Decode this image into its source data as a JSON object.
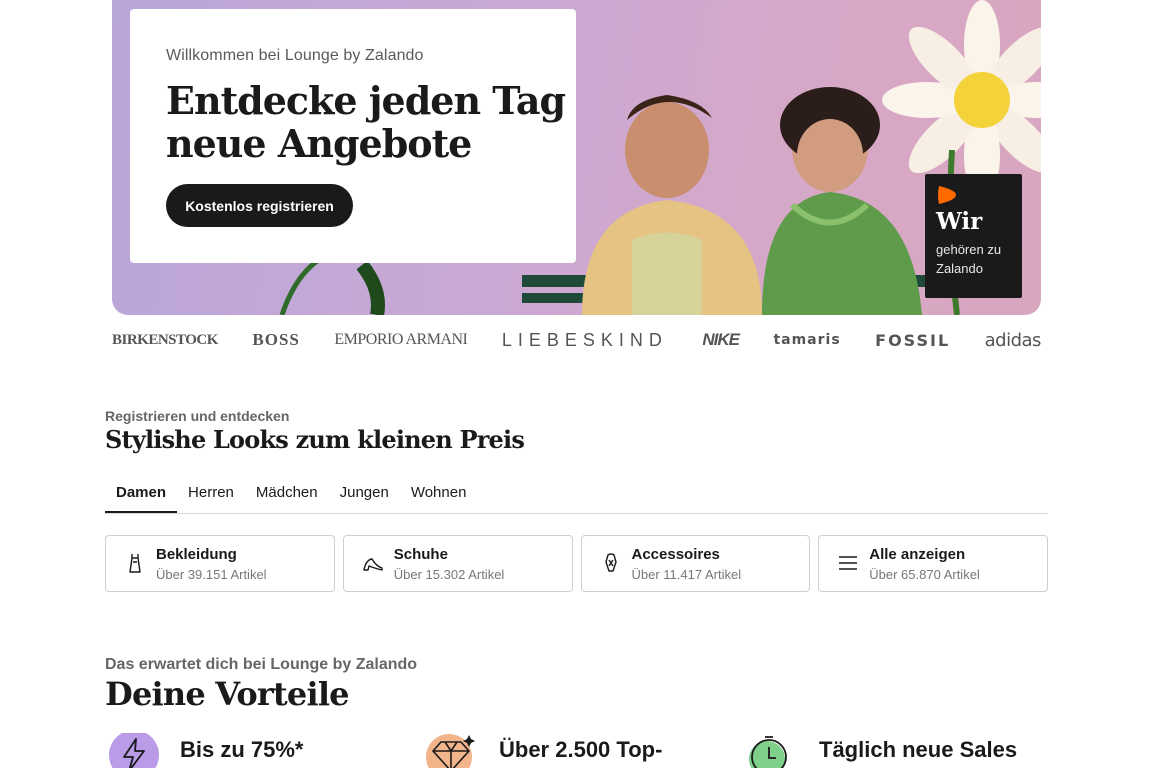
{
  "hero": {
    "subtitle": "Willkommen bei Lounge by Zalando",
    "title_line1": "Entdecke jeden Tag",
    "title_line2": "neue Angebote",
    "cta_label": "Kostenlos registrieren",
    "badge": {
      "title": "Wir",
      "line1": "gehören zu",
      "line2": "Zalando"
    }
  },
  "brands": [
    "BIRKENSTOCK",
    "BOSS",
    "EMPORIO ARMANI",
    "LIEBESKIND",
    "NIKE",
    "tamaris",
    "FOSSIL",
    "adidas"
  ],
  "discover": {
    "subtitle": "Registrieren und entdecken",
    "title": "Stylishe Looks zum kleinen Preis",
    "tabs": [
      {
        "label": "Damen",
        "active": true
      },
      {
        "label": "Herren",
        "active": false
      },
      {
        "label": "Mädchen",
        "active": false
      },
      {
        "label": "Jungen",
        "active": false
      },
      {
        "label": "Wohnen",
        "active": false
      }
    ],
    "categories": [
      {
        "name": "Bekleidung",
        "count": "Über 39.151 Artikel",
        "icon": "dress-icon"
      },
      {
        "name": "Schuhe",
        "count": "Über 15.302 Artikel",
        "icon": "heel-shoe-icon"
      },
      {
        "name": "Accessoires",
        "count": "Über 11.417 Artikel",
        "icon": "accessory-icon"
      },
      {
        "name": "Alle anzeigen",
        "count": "Über 65.870 Artikel",
        "icon": "list-icon"
      }
    ]
  },
  "benefits": {
    "subtitle": "Das erwartet dich bei Lounge by Zalando",
    "title": "Deine Vorteile",
    "items": [
      {
        "text": "Bis zu 75%*",
        "icon": "lightning-percent-icon",
        "color": "#b99be8"
      },
      {
        "text": "Über 2.500 Top-",
        "icon": "diamond-icon",
        "color": "#f2b48a"
      },
      {
        "text": "Täglich neue Sales",
        "icon": "stopwatch-icon",
        "color": "#7ed08a"
      }
    ]
  },
  "colors": {
    "accent_orange": "#ff6900",
    "dark": "#1a1a1a"
  }
}
